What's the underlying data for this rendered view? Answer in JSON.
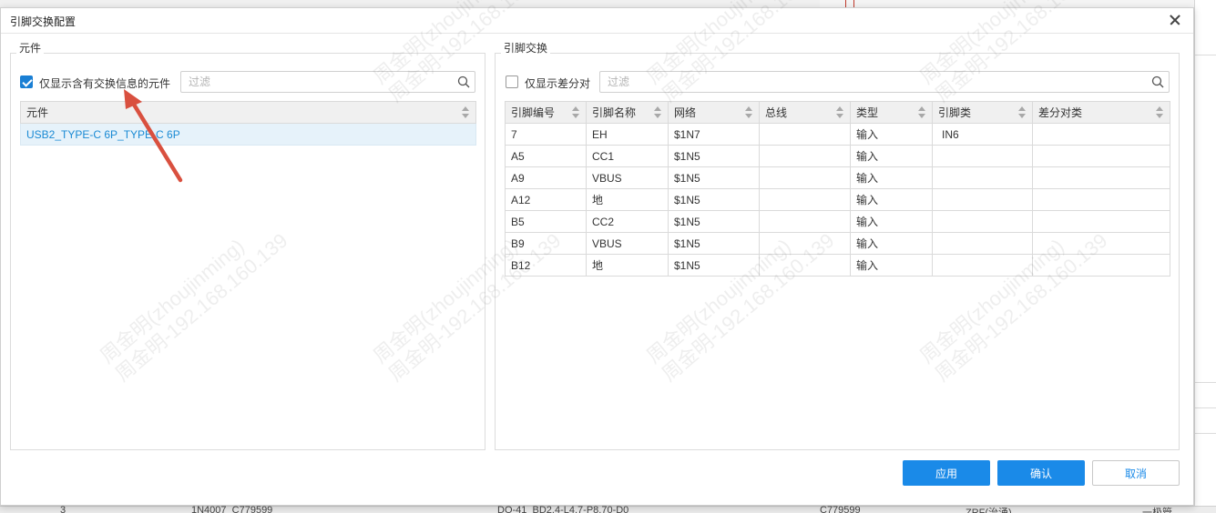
{
  "dialog": {
    "title": "引脚交换配置"
  },
  "left_panel": {
    "title": "元件",
    "checkbox_label": "仅显示含有交换信息的元件",
    "checkbox_checked": true,
    "filter_placeholder": "过滤",
    "table": {
      "headers": [
        "元件"
      ],
      "rows": [
        [
          "USB2_TYPE-C 6P_TYPE-C 6P"
        ]
      ]
    }
  },
  "right_panel": {
    "title": "引脚交换",
    "checkbox_label": "仅显示差分对",
    "checkbox_checked": false,
    "filter_placeholder": "过滤",
    "table": {
      "headers": [
        "引脚编号",
        "引脚名称",
        "网络",
        "总线",
        "类型",
        "引脚类",
        "差分对类"
      ],
      "rows": [
        [
          "7",
          "EH",
          "$1N7",
          "",
          "输入",
          "IN6",
          ""
        ],
        [
          "A5",
          "CC1",
          "$1N5",
          "",
          "输入",
          "",
          ""
        ],
        [
          "A9",
          "VBUS",
          "$1N5",
          "",
          "输入",
          "",
          ""
        ],
        [
          "A12",
          "地",
          "$1N5",
          "",
          "输入",
          "",
          ""
        ],
        [
          "B5",
          "CC2",
          "$1N5",
          "",
          "输入",
          "",
          ""
        ],
        [
          "B9",
          "VBUS",
          "$1N5",
          "",
          "输入",
          "",
          ""
        ],
        [
          "B12",
          "地",
          "$1N5",
          "",
          "输入",
          "",
          ""
        ]
      ]
    }
  },
  "buttons": {
    "apply": "应用",
    "confirm": "确认",
    "cancel": "取消"
  },
  "watermark": {
    "line1": "周金明(zhoujinming)",
    "line2": "周金明-192.168.160.139"
  },
  "background": {
    "bottom_row": [
      "3",
      "1N4007_C779599",
      "DO-41_BD2.4-L4.7-P8.70-D0",
      "C779599",
      "ZRF(治涌)",
      "一极管"
    ]
  },
  "colors": {
    "primary": "#1a8ae8",
    "selected_row_bg": "#e6f2fa",
    "selected_row_text": "#1a8ad4",
    "annotation_arrow": "#d9503f"
  }
}
